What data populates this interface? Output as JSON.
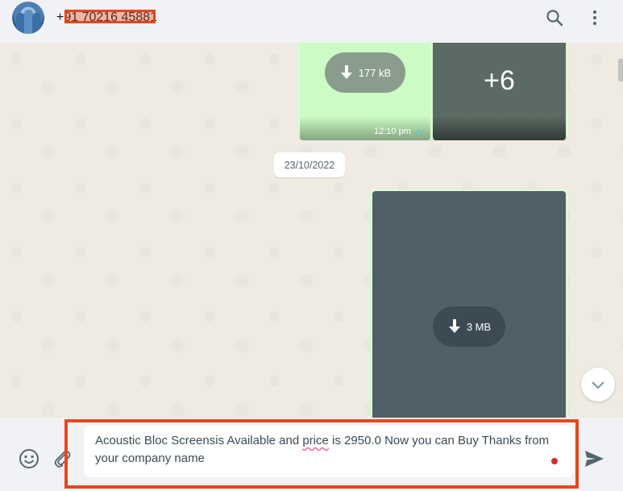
{
  "header": {
    "contact_name": "+91 70216 45881",
    "icons": [
      "avatar",
      "search-icon",
      "menu-icon"
    ]
  },
  "messages": [
    {
      "type": "image-album",
      "download_size": "177 kB",
      "more_count": "+6",
      "time": "12:10 pm",
      "status_ticks": "✓✓"
    },
    {
      "type": "date-chip",
      "date": "23/10/2022"
    },
    {
      "type": "image",
      "download_size": "3 MB"
    }
  ],
  "composer": {
    "text_before": "Acoustic Bloc Screensis Available and ",
    "misspelled_word": "price",
    "text_after": " is 2950.0  Now you can Buy Thanks from your company name",
    "icons": [
      "emoji-icon",
      "attach-icon",
      "send-icon"
    ]
  },
  "colors": {
    "header_bg": "#f0f2f5",
    "chat_bg": "#efeae2",
    "outgoing_bubble": "#d9fdd3",
    "annotation_red": "#e8461b",
    "read_ticks": "#53bdeb"
  }
}
